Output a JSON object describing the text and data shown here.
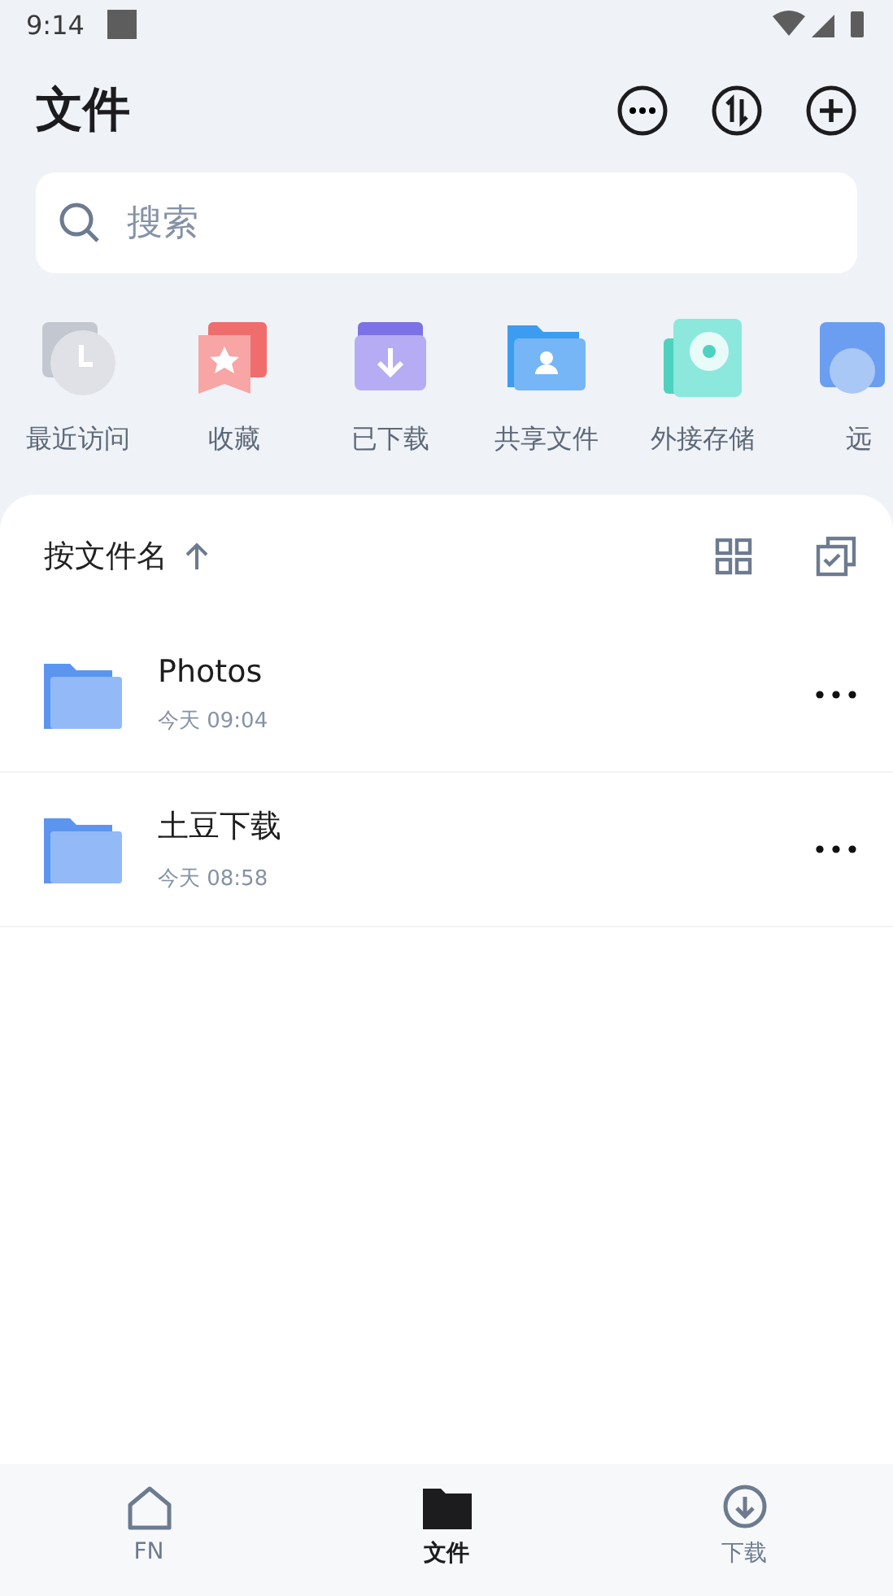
{
  "status_bar": {
    "time": "9:14"
  },
  "header": {
    "title": "文件"
  },
  "search": {
    "placeholder": "搜索"
  },
  "shortcuts": [
    {
      "kind": "clock",
      "label": "最近访问"
    },
    {
      "kind": "star",
      "label": "收藏"
    },
    {
      "kind": "download",
      "label": "已下载"
    },
    {
      "kind": "share",
      "label": "共享文件"
    },
    {
      "kind": "disk",
      "label": "外接存储"
    },
    {
      "kind": "cloud",
      "label": "远"
    }
  ],
  "sort": {
    "label": "按文件名"
  },
  "files": [
    {
      "name": "Photos",
      "modified": "今天 09:04"
    },
    {
      "name": "土豆下载",
      "modified": "今天 08:58"
    }
  ],
  "tabs": [
    {
      "kind": "home",
      "label": "FN",
      "selected": false
    },
    {
      "kind": "folder",
      "label": "文件",
      "selected": true
    },
    {
      "kind": "download",
      "label": "下载",
      "selected": false
    }
  ]
}
